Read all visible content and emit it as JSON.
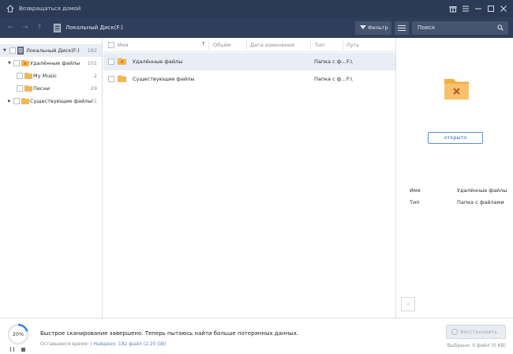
{
  "titlebar": {
    "back_home": "Возвращаться домой",
    "icons": [
      "home-icon",
      "gift-icon",
      "menu-icon",
      "minimize-icon",
      "maximize-icon",
      "close-icon"
    ]
  },
  "navbar": {
    "breadcrumb": "Локальный Диск(F:)",
    "filter_label": "Фильтр",
    "search_placeholder": "Поиск"
  },
  "tree": [
    {
      "label": "Локальный Диск(F:)",
      "count": "182"
    },
    {
      "label": "Удалённые файлы",
      "count": "101"
    },
    {
      "label": "My Music",
      "count": "2"
    },
    {
      "label": "Песни",
      "count": "29"
    },
    {
      "label": "Существующие файлы",
      "count": "81"
    }
  ],
  "list": {
    "headers": {
      "name": "Имя",
      "size": "Объём",
      "date": "Дата изменения",
      "type": "Тип",
      "path": "Путь"
    },
    "rows": [
      {
        "name": "Удалённые файлы",
        "type": "Папка с ф...",
        "path": "F:\\"
      },
      {
        "name": "Существующие файлы",
        "type": "Папка с ф...",
        "path": "F:\\"
      }
    ]
  },
  "preview": {
    "open_label": "открыто",
    "props": [
      {
        "key": "Имя",
        "value": "Удалённые файлы"
      },
      {
        "key": "Тип",
        "value": "Папка с файлами"
      }
    ]
  },
  "status": {
    "progress_percent": 20,
    "progress_label": "20%",
    "message": "Быстрое сканирование завершено. Теперь пытаюсь найти больше потерянных данных.",
    "remaining_label": "Оставшееся время: /",
    "found_label": "Найдено: 182 файл (2.20 GB)",
    "restore_label": "Восстановить",
    "selected_label": "Выбрано: 0 файл (0 KB)"
  },
  "colors": {
    "titlebar_bg": "#2b3a55",
    "navbar_bg": "#2f3e5b",
    "accent": "#3b6fb5",
    "folder": "#f5b74e",
    "deleted_mark": "#d9662a"
  }
}
